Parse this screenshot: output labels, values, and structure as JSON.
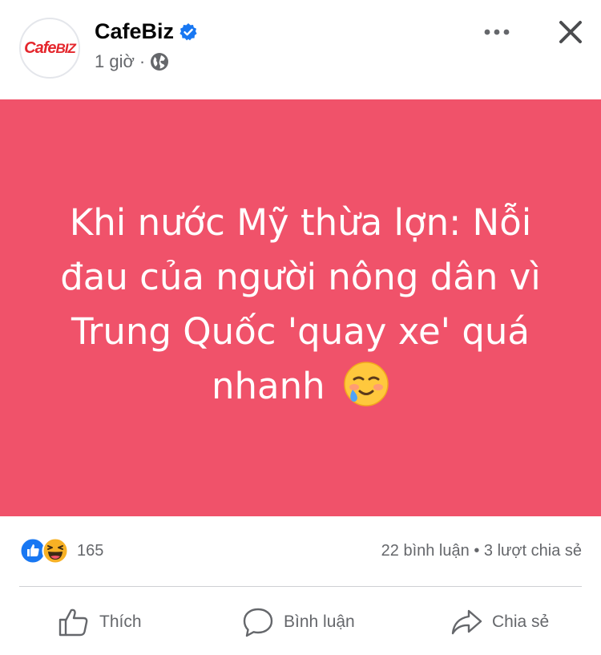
{
  "post": {
    "page_name": "CafeBiz",
    "time": "1 giờ",
    "separator": "·",
    "logo_text_left": "Cafe",
    "logo_text_right": "BIZ",
    "card_text": "Khi nước Mỹ thừa lợn: Nỗi đau của người nông dân vì Trung Quốc 'quay xe' quá nhanh",
    "card_color": "#f0526a"
  },
  "stats": {
    "reaction_count": "165",
    "comments": "22 bình luận",
    "dot": "•",
    "shares": "3 lượt chia sẻ"
  },
  "actions": {
    "like": "Thích",
    "comment": "Bình luận",
    "share": "Chia sẻ"
  },
  "icons": [
    "verified-badge-icon",
    "globe-icon",
    "more-options-icon",
    "close-icon",
    "like-reaction-icon",
    "haha-reaction-icon",
    "smiling-tear-emoji-icon",
    "thumbs-up-icon",
    "comment-bubble-icon",
    "share-arrow-icon"
  ]
}
